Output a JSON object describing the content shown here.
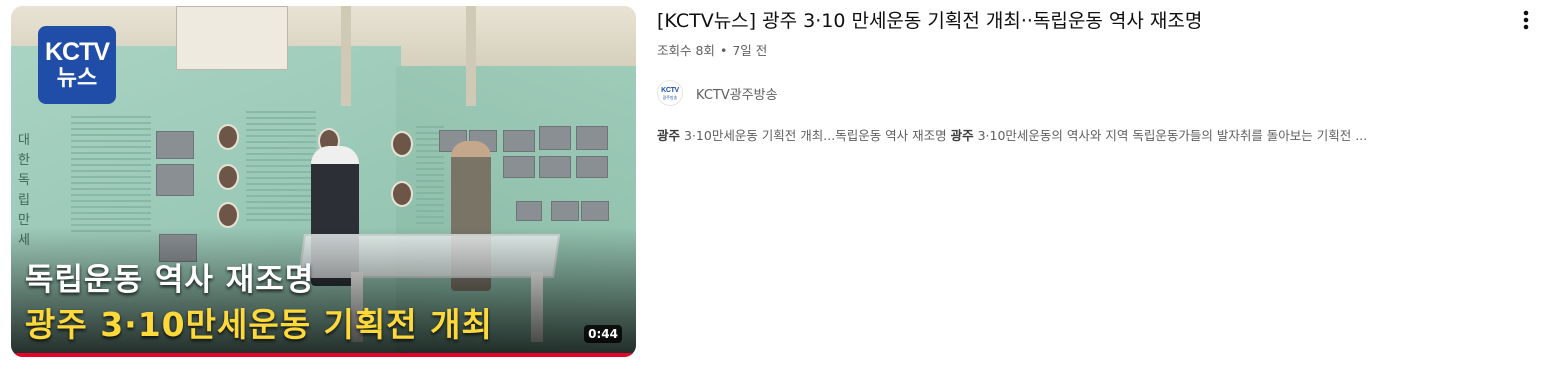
{
  "thumbnail": {
    "logo_line1": "KCTV",
    "logo_line2": "뉴스",
    "headline_line1": "독립운동 역사 재조명",
    "headline_line2": "광주 3·10만세운동 기획전 개최",
    "scene_vertical_text": "대한독립만세",
    "duration": "0:44",
    "progress_fraction": 1.0
  },
  "video": {
    "title": "[KCTV뉴스] 광주 3·10 만세운동 기획전 개최··독립운동 역사 재조명",
    "views": "조회수 8회",
    "separator": "•",
    "age": "7일 전"
  },
  "channel": {
    "avatar_line1": "KCTV",
    "avatar_line2": "광주방송",
    "name": "KCTV광주방송"
  },
  "description": {
    "segments": [
      {
        "text": "광주",
        "bold": true
      },
      {
        "text": " 3·10만세운동 기획전 개최...독립운동 역사 재조명 ",
        "bold": false
      },
      {
        "text": "광주",
        "bold": true
      },
      {
        "text": " 3·10만세운동의 역사와 지역 독립운동가들의 발자취를 돌아보는 기획전 ...",
        "bold": false
      }
    ]
  },
  "icons": {
    "menu": "more-vert-icon"
  },
  "colors": {
    "progress": "#e5002b",
    "headline_highlight": "#ffd83a",
    "logo_bg": "#1f4da8"
  }
}
